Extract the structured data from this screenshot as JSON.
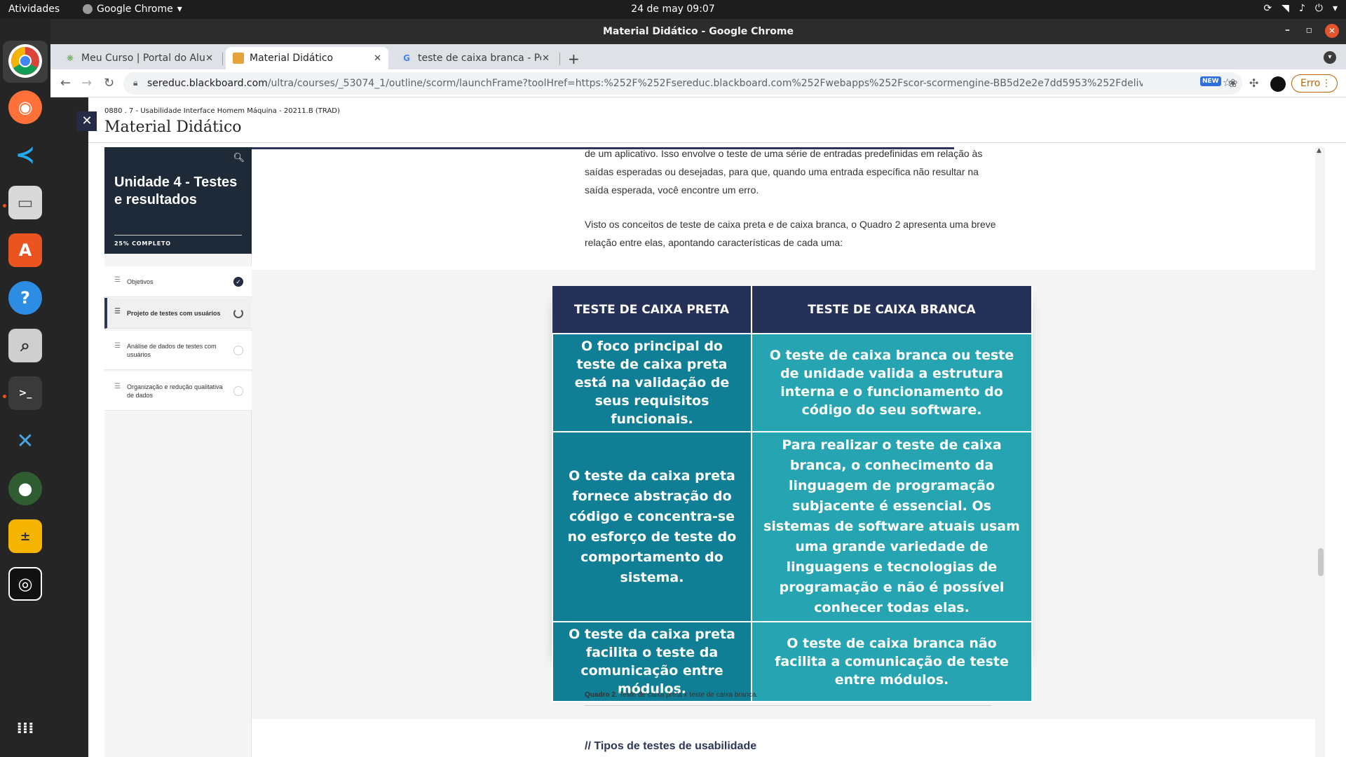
{
  "os": {
    "activities": "Atividades",
    "app_menu": "Google Chrome",
    "clock": "24 de may  09:07"
  },
  "window": {
    "title": "Material Didático - Google Chrome"
  },
  "tabs": [
    {
      "label": "Meu Curso | Portal do Alu",
      "active": false
    },
    {
      "label": "Material Didático",
      "active": true
    },
    {
      "label": "teste de caixa branca - Pe",
      "active": false
    }
  ],
  "toolbar": {
    "url_host": "sereduc.blackboard.com",
    "url_path": "/ultra/courses/_53074_1/outline/scorm/launchFrame?toolHref=https:%252F%252Fsereduc.blackboard.com%252Fwebapps%252Fscor-scormengine-BB5d2e2e7dd5953%252Fdelivery%3Faction%3Dl...",
    "error_label": "Erro",
    "new_badge": "NEW"
  },
  "course": {
    "breadcrumb": "0880 . 7 - Usabilidade Interface Homem Máquina - 20211.B (TRAD)",
    "title": "Material Didático"
  },
  "sidebar": {
    "unit_title": "Unidade 4 - Testes e resultados",
    "progress_label": "25% COMPLETO",
    "progress": 0.25,
    "lessons": [
      {
        "label": "Objetivos",
        "status": "complete"
      },
      {
        "label": "Projeto de testes com usuários",
        "status": "in-progress"
      },
      {
        "label": "Análise de dados de testes com usuários",
        "status": "not-started"
      },
      {
        "label": "Organização e redução qualitativa de dados",
        "status": "not-started"
      }
    ]
  },
  "content": {
    "para1": "de um aplicativo. Isso envolve o teste de uma série de entradas predefinidas em relação às saídas esperadas ou desejadas, para que, quando uma entrada específica não resultar na saída esperada, você encontre um erro.",
    "para2": "Visto os conceitos de teste de caixa preta e de caixa branca, o Quadro 2 apresenta uma breve relação entre elas, apontando características de cada uma:",
    "table": {
      "headers": [
        "TESTE DE CAIXA PRETA",
        "TESTE DE CAIXA BRANCA"
      ],
      "rows": [
        [
          "O foco principal do teste de caixa preta está na validação de seus requisitos funcionais.",
          "O teste de caixa branca ou teste de unidade valida a estrutura interna e o funcionamento do código do seu software."
        ],
        [
          "O teste da caixa preta fornece abstração do código e concentra-se no esforço de teste do comportamento do sistema.",
          "Para realizar o teste de caixa branca, o conhecimento da linguagem de programação subjacente é essencial. Os sistemas de software atuais usam uma grande variedade de linguagens e tecnologias de programação e não é possível conhecer todas elas."
        ],
        [
          "O teste da caixa preta facilita o teste da comunicação entre módulos.",
          "O teste de caixa branca não facilita a comunicação de teste entre módulos."
        ]
      ]
    },
    "caption_bold": "Quadro 2",
    "caption_text": ". Teste de caixa preta x teste de caixa branca.",
    "section_heading": "// Tipos de testes de usabilidade"
  },
  "colors": {
    "header_navy": "#263157",
    "cell_left": "#107f95",
    "cell_right": "#27a4b2",
    "error_orange": "#c26401"
  }
}
